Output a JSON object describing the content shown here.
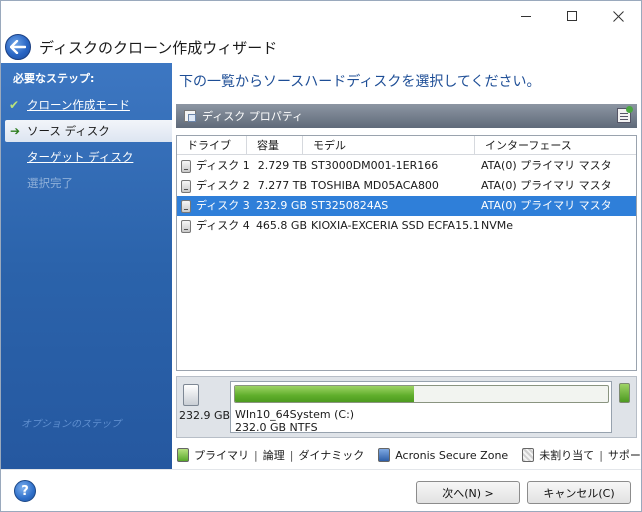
{
  "window": {
    "controls": {
      "minimize": "—",
      "maximize": "☐",
      "close": "✕"
    }
  },
  "header": {
    "title": "ディスクのクローン作成ウィザード"
  },
  "sidebar": {
    "heading": "必要なステップ:",
    "steps": [
      {
        "label": "クローン作成モード",
        "state": "done",
        "icon": "✔"
      },
      {
        "label": "ソース ディスク",
        "state": "active",
        "icon": "➔"
      },
      {
        "label": "ターゲット ディスク",
        "state": "link",
        "icon": ""
      },
      {
        "label": "選択完了",
        "state": "disabled",
        "icon": ""
      }
    ],
    "watermark": "オプションのステップ"
  },
  "main": {
    "title": "下の一覧からソースハードディスクを選択してください。",
    "properties_label": "ディスク プロパティ"
  },
  "table": {
    "columns": [
      "ドライブ",
      "容量",
      "モデル",
      "インターフェース"
    ],
    "rows": [
      {
        "drive": "ディスク 1",
        "capacity": "2.729 TB",
        "model": "ST3000DM001-1ER166",
        "interface": "ATA(0) プライマリ マスタ",
        "selected": false
      },
      {
        "drive": "ディスク 2",
        "capacity": "7.277 TB",
        "model": "TOSHIBA MD05ACA800",
        "interface": "ATA(0) プライマリ マスタ",
        "selected": false
      },
      {
        "drive": "ディスク 3",
        "capacity": "232.9 GB",
        "model": "ST3250824AS",
        "interface": "ATA(0) プライマリ マスタ",
        "selected": true
      },
      {
        "drive": "ディスク 4",
        "capacity": "465.8 GB",
        "model": "KIOXIA-EXCERIA SSD ECFA15.1",
        "interface": "NVMe",
        "selected": false
      }
    ]
  },
  "partition": {
    "disk_size": "232.9 GB",
    "name": "WIn10_64System (C:)",
    "info": "232.0 GB  NTFS",
    "used_fraction": 0.48
  },
  "legend": {
    "primary": "プライマリ",
    "logical": "論理",
    "dynamic": "ダイナミック",
    "acronis": "Acronis Secure Zone",
    "unallocated": "未割り当て",
    "unsupported": "サポート外"
  },
  "footer": {
    "help": "?",
    "next": "次へ(N) >",
    "cancel": "キャンセル(C)"
  },
  "colors": {
    "sidebar": "#2b63ab",
    "title_blue": "#1e4e96",
    "selection": "#2f7fd9",
    "partition_green": "#5fae2b"
  }
}
